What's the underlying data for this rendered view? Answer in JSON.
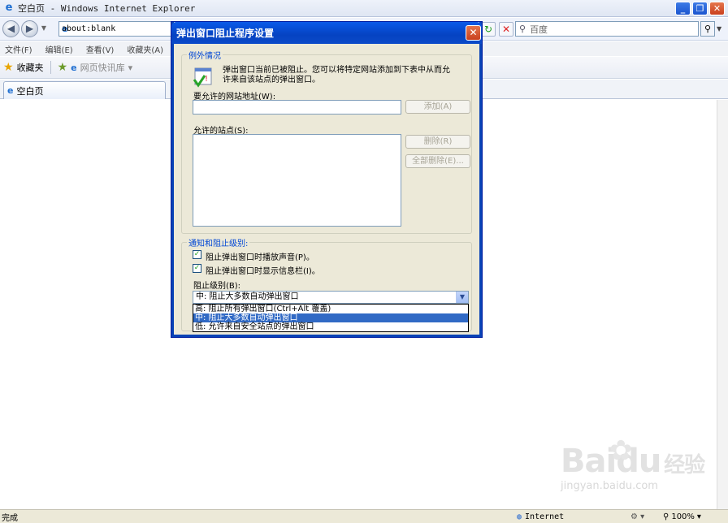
{
  "window": {
    "title": "空白页 - Windows Internet Explorer",
    "min": "_",
    "max": "❐",
    "close": "✕"
  },
  "toolbar": {
    "url": "about:blank",
    "search_placeholder": "百度"
  },
  "menu": [
    "文件(F)",
    "编辑(E)",
    "查看(V)",
    "收藏夹(A)"
  ],
  "favorites": {
    "label": "收藏夹",
    "quick_links": "网页快讯库"
  },
  "tab": {
    "label": "空白页"
  },
  "statusbar": {
    "status": "完成",
    "zone": "Internet",
    "zoom": "100%"
  },
  "dialog": {
    "title": "弹出窗口阻止程序设置",
    "exceptions_group": "例外情况",
    "info_text_1": "弹出窗口当前已被阻止。您可以将特定网站添加到下表中从而允",
    "info_text_2": "许来自该站点的弹出窗口。",
    "address_label": "要允许的网站地址(W):",
    "add_button": "添加(A)",
    "allowed_label": "允许的站点(S):",
    "remove_button": "删除(R)",
    "remove_all_button": "全部删除(E)...",
    "notify_group": "通知和阻止级别:",
    "checkbox_sound": "阻止弹出窗口时播放声音(P)。",
    "checkbox_infobar": "阻止弹出窗口时显示信息栏(I)。",
    "level_label": "阻止级别(B):",
    "level_selected": "中: 阻止大多数自动弹出窗口",
    "level_options": [
      "高: 阻止所有弹出窗口(Ctrl+Alt 覆盖)",
      "中: 阻止大多数自动弹出窗口",
      "低: 允许来自安全站点的弹出窗口"
    ]
  },
  "watermark": {
    "brand": "Bai",
    "brand2": "经验",
    "url": "jingyan.baidu.com"
  }
}
